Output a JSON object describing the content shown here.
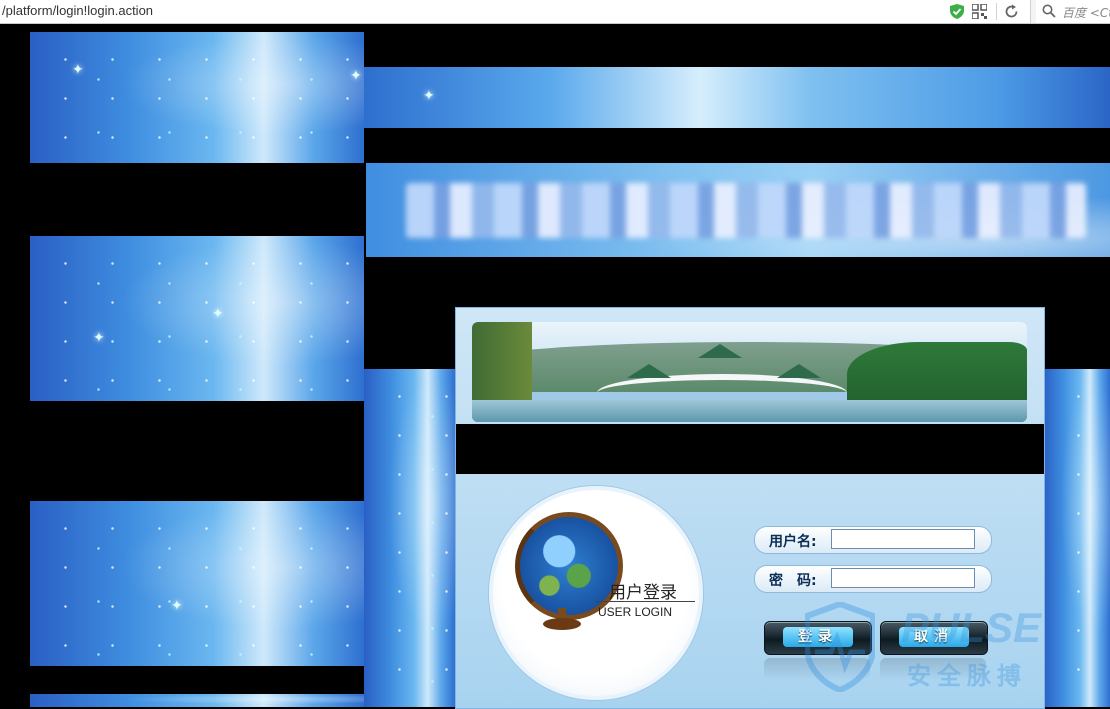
{
  "browser": {
    "url": "/platform/login!login.action",
    "search_placeholder": "百度 <Ct",
    "icons": [
      "shield-icon",
      "qr-code-icon",
      "refresh-icon",
      "search-icon"
    ]
  },
  "login_panel": {
    "title_cn": "用户登录",
    "title_en": "USER LOGIN",
    "username_label": "用户名:",
    "password_label": "密　码:",
    "username_value": "",
    "password_value": "",
    "login_button": "登录",
    "cancel_button": "取消"
  },
  "watermark": {
    "text": "PULSE",
    "subtext": "安全脉搏"
  },
  "colors": {
    "accent": "#2aa8e8",
    "label": "#0b2d58",
    "panel": "#a8d3f0"
  }
}
